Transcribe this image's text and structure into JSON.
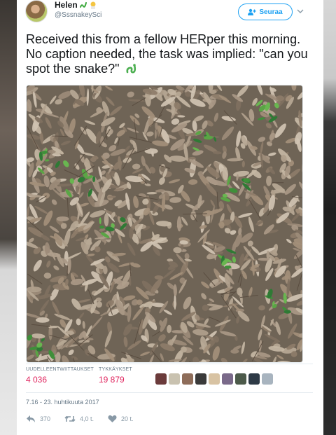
{
  "author": {
    "name": "Helen",
    "handle": "@SssnakeySci"
  },
  "follow_button": {
    "label": "Seuraa"
  },
  "tweet": {
    "text": "Received this from a fellow HERper this morning. No caption needed, the task was implied: \"can you spot the snake?\""
  },
  "stats": {
    "retweets_label": "UUDELLEENTWIITTAUKSET",
    "retweets_value": "4 036",
    "likes_label": "TYKKÄYKSET",
    "likes_value": "19 879"
  },
  "timestamp": "7.16 - 23. huhtikuuta 2017",
  "actions": {
    "reply_count": "370",
    "retweet_count": "4,0 t.",
    "like_count": "20 t."
  },
  "colors": {
    "accent": "#1da1f2",
    "likes": "#e0245e",
    "muted": "#657786"
  },
  "icons": {
    "follow": "add-user-icon",
    "menu": "chevron-down-icon",
    "reply": "reply-icon",
    "retweet": "retweet-icon",
    "like": "heart-icon",
    "emoji": "snake-emoji-icon"
  }
}
